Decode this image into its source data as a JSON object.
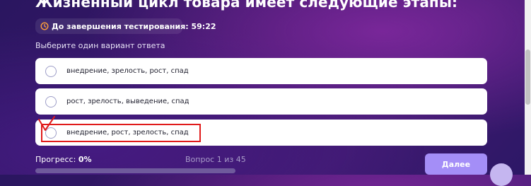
{
  "question": {
    "title": "Жизненный цикл товара имеет следующие этапы:"
  },
  "timer": {
    "icon": "clock-icon",
    "accent_color": "#ff9f3a",
    "text": "До завершения тестирования: 59:22"
  },
  "instruction": "Выберите один вариант ответа",
  "options": [
    {
      "label": "внедрение, зрелость, рост, спад",
      "selected": false
    },
    {
      "label": "рост, зрелость, выведение, спад",
      "selected": false
    },
    {
      "label": "внедрение, рост, зрелость, спад",
      "selected": false,
      "annotated": true
    }
  ],
  "annotation": {
    "color": "#e01b1b",
    "shapes": [
      "checkmark",
      "rectangle"
    ]
  },
  "progress": {
    "label": "Прогресс:",
    "value": "0%",
    "fraction": 0
  },
  "counter": "Вопрос 1 из 45",
  "next_button": {
    "label": "Далее",
    "color": "#a48ef7"
  },
  "chat_widget": {
    "icon": "chat-icon"
  }
}
